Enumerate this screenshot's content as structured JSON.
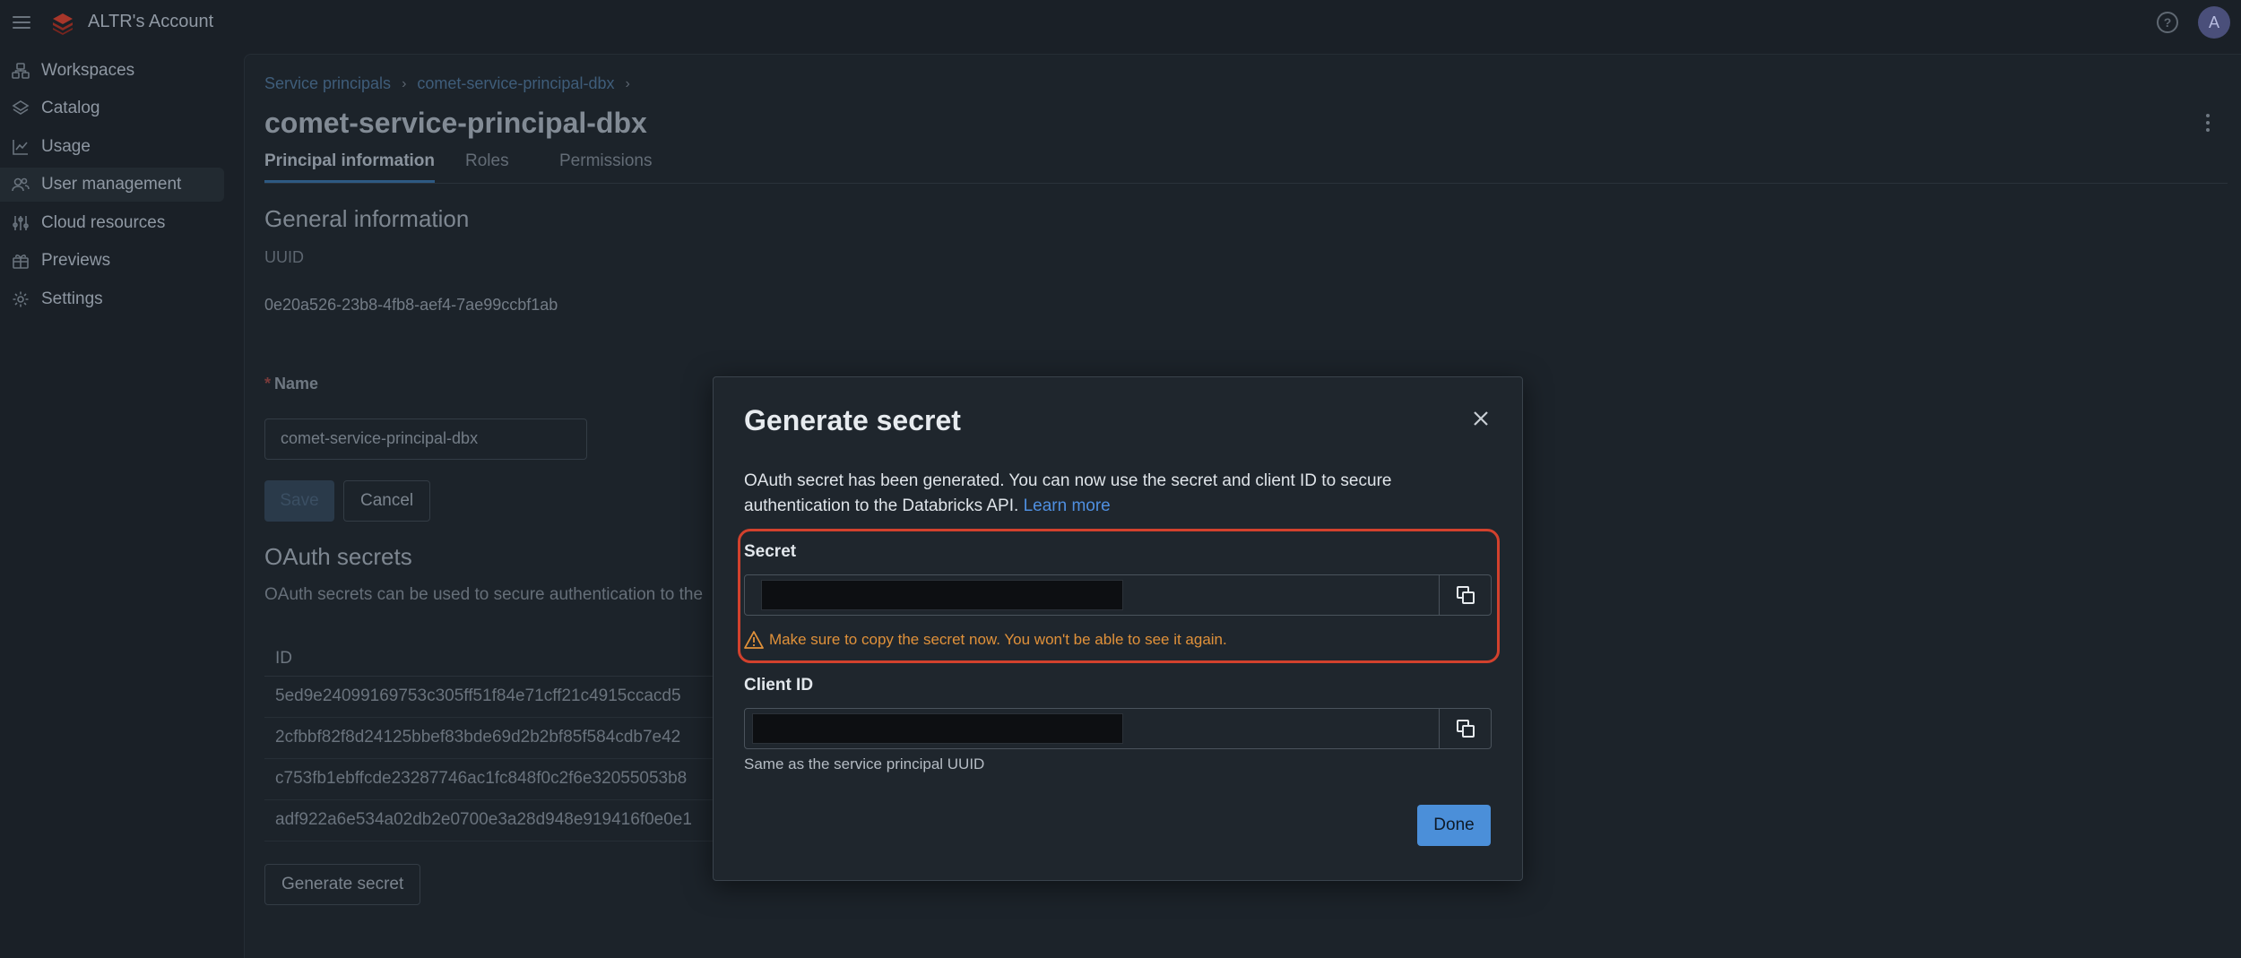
{
  "topbar": {
    "account_name": "ALTR's Account",
    "help_icon": "?",
    "avatar_initial": "A"
  },
  "sidebar": {
    "items": [
      {
        "label": "Workspaces",
        "icon": "workspaces-icon"
      },
      {
        "label": "Catalog",
        "icon": "catalog-icon"
      },
      {
        "label": "Usage",
        "icon": "usage-icon"
      },
      {
        "label": "User management",
        "icon": "users-icon",
        "active": true
      },
      {
        "label": "Cloud resources",
        "icon": "cloud-resources-icon"
      },
      {
        "label": "Previews",
        "icon": "previews-icon"
      },
      {
        "label": "Settings",
        "icon": "gear-icon"
      }
    ]
  },
  "main": {
    "breadcrumb": [
      "Service principals",
      "comet-service-principal-dbx"
    ],
    "title": "comet-service-principal-dbx",
    "tabs": [
      "Principal information",
      "Roles",
      "Permissions"
    ],
    "general": {
      "title": "General information",
      "uuid_label": "UUID",
      "uuid_value": "0e20a526-23b8-4fb8-aef4-7ae99ccbf1ab",
      "name_required": "*",
      "name_label": "Name",
      "name_value": "comet-service-principal-dbx",
      "save_label": "Save",
      "cancel_label": "Cancel"
    },
    "oauth": {
      "title": "OAuth secrets",
      "description": "OAuth secrets can be used to secure authentication to the",
      "id_header": "ID",
      "rows": [
        "5ed9e24099169753c305ff51f84e71cff21c4915ccacd5",
        "2cfbbf82f8d24125bbef83bde69d2b2bf85f584cdb7e42",
        "c753fb1ebffcde23287746ac1fc848f0c2f6e32055053b8",
        "adf922a6e534a02db2e0700e3a28d948e919416f0e0e1"
      ],
      "generate_label": "Generate secret"
    }
  },
  "modal": {
    "title": "Generate secret",
    "text": "OAuth secret has been generated. You can now use the secret and client ID to secure authentication to the Databricks API. ",
    "learn_more": "Learn more",
    "secret_label": "Secret",
    "warning": "Make sure to copy the secret now. You won't be able to see it again.",
    "client_label": "Client ID",
    "client_help": "Same as the service principal UUID",
    "done_label": "Done"
  },
  "colors": {
    "accent": "#4b8fd9",
    "highlight": "#d2412d",
    "warning": "#e0913a"
  }
}
